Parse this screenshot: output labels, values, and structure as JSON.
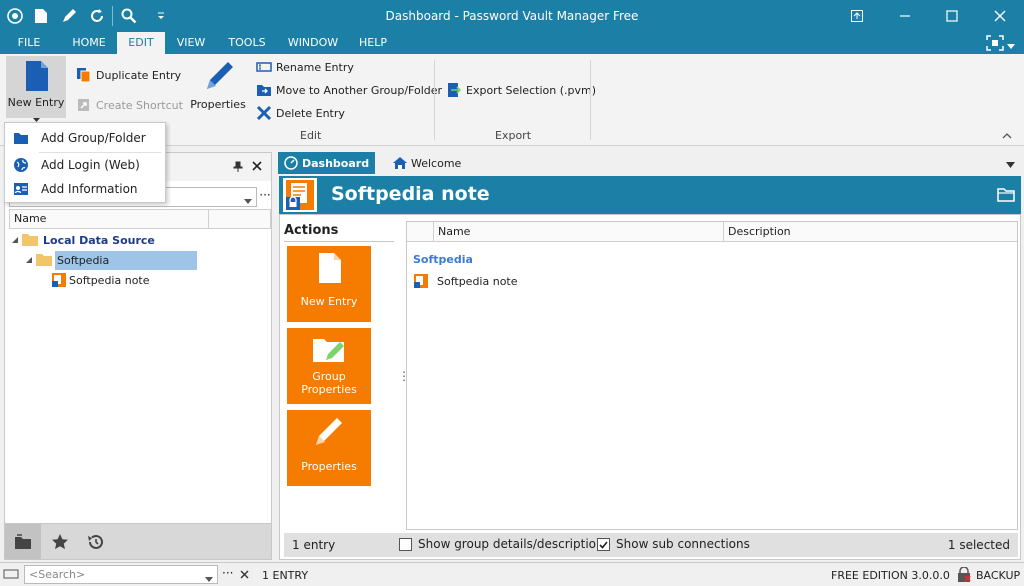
{
  "window": {
    "title": "Dashboard - Password Vault Manager Free"
  },
  "menu": {
    "tabs": [
      "FILE",
      "HOME",
      "EDIT",
      "VIEW",
      "TOOLS",
      "WINDOW",
      "HELP"
    ],
    "active": "EDIT"
  },
  "ribbon": {
    "new_entry": "New Entry",
    "duplicate_entry": "Duplicate Entry",
    "create_shortcut": "Create Shortcut",
    "properties": "Properties",
    "rename_entry": "Rename Entry",
    "move_entry": "Move to Another Group/Folder",
    "delete_entry": "Delete Entry",
    "edit_group": "Edit",
    "export_selection": "Export Selection (.pvm)",
    "export_group": "Export"
  },
  "dropdown": {
    "items": [
      "Add Group/Folder",
      "Add Login (Web)",
      "Add Information"
    ]
  },
  "left_panel": {
    "column_name": "Name",
    "tree": {
      "root": "Local Data Source",
      "folder": "Softpedia",
      "entry": "Softpedia note"
    }
  },
  "tabs": {
    "dashboard": "Dashboard",
    "welcome": "Welcome"
  },
  "dashboard": {
    "title": "Softpedia note",
    "actions_title": "Actions",
    "tiles": [
      "New Entry",
      "Group Properties",
      "Properties"
    ],
    "tile_lines": {
      "group_line1": "Group",
      "group_line2": "Properties"
    },
    "list": {
      "col_name": "Name",
      "col_description": "Description",
      "group_header": "Softpedia",
      "item": "Softpedia note"
    },
    "status": {
      "count": "1 entry",
      "show_group_details": "Show group details/description",
      "show_sub_connections": "Show sub connections",
      "selected": "1 selected"
    }
  },
  "statusbar": {
    "search_placeholder": "<Search>",
    "entries": "1 ENTRY",
    "edition": "FREE EDITION 3.0.0.0",
    "backup": "BACKUP"
  },
  "colors": {
    "accent": "#1c7fa6",
    "tile": "#f57c00",
    "selection": "#9ec5e8",
    "group_link": "#3a7bd5"
  }
}
